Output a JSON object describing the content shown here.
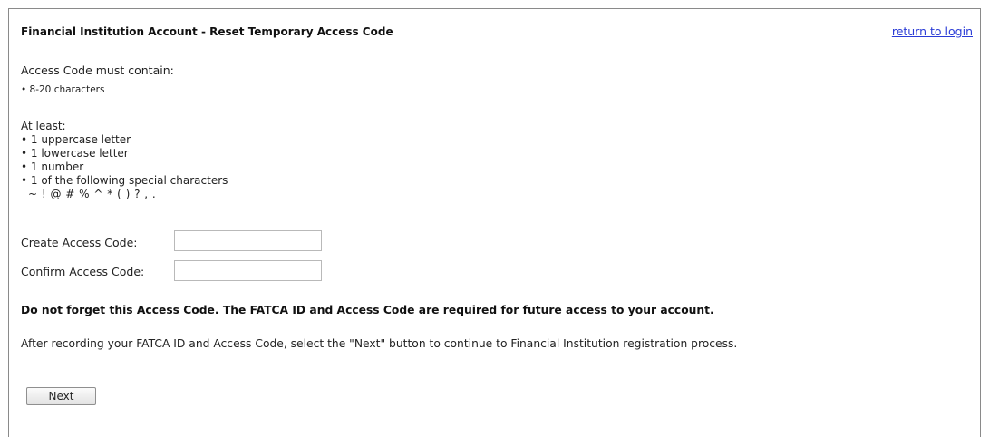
{
  "header": {
    "title": "Financial Institution Account - Reset Temporary Access Code",
    "return_link": "return to login"
  },
  "requirements": {
    "heading": "Access Code must contain:",
    "length_rule": "• 8-20 characters",
    "at_least_heading": "At least:",
    "rules": [
      "• 1 uppercase letter",
      "• 1 lowercase letter",
      "• 1 number",
      "• 1 of the following special characters"
    ],
    "special_characters": "~ ! @ # % ^ * ( ) ? , ."
  },
  "form": {
    "create_label": "Create Access Code:",
    "create_value": "",
    "confirm_label": "Confirm Access Code:",
    "confirm_value": ""
  },
  "messages": {
    "warning": "Do not forget this Access Code. The FATCA ID and Access Code are required for future access to your account.",
    "instruction": "After recording your FATCA ID and Access Code, select the \"Next\" button to continue to Financial Institution registration process."
  },
  "actions": {
    "next_label": "Next"
  }
}
